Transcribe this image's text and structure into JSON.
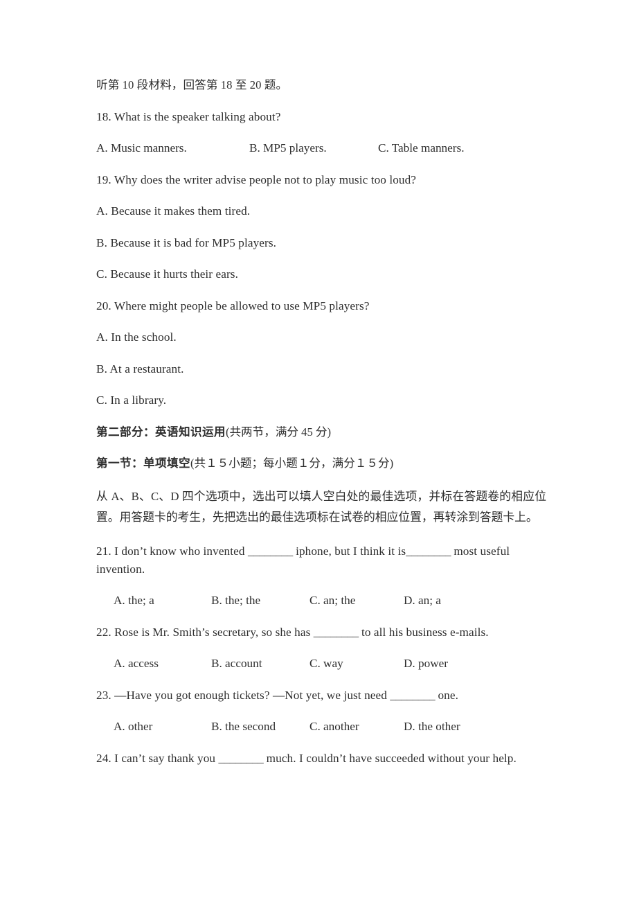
{
  "document": {
    "listening_intro": "听第 10 段材料，回答第 18 至 20 题。",
    "questions": [
      {
        "stem": "18. What is the speaker talking about?",
        "options_inline": [
          "A. Music manners.",
          "B. MP5 players.",
          "C. Table manners."
        ]
      },
      {
        "stem": "19. Why does the writer advise people not to play music too loud?",
        "options_stacked": [
          "A. Because it makes them tired.",
          "B. Because it is bad for MP5 players.",
          "C. Because it hurts their ears."
        ]
      },
      {
        "stem": "20. Where might people be allowed to use MP5 players?",
        "options_stacked": [
          "A. In the school.",
          "B. At a restaurant.",
          "C. In a library."
        ]
      }
    ],
    "section_part2": {
      "lead": "第二部分：英语知识运用",
      "rest": "(共两节，满分 45 分)"
    },
    "section_part2_sub1": {
      "lead": "第一节：单项填空",
      "rest": "(共１５小题；每小题１分，满分１５分)"
    },
    "instructions": "从 A、B、C、D 四个选项中，选出可以填人空白处的最佳选项，并标在答题卷的相应位置。用答题卡的考生，先把选出的最佳选项标在试卷的相应位置，再转涂到答题卡上。",
    "grammar_questions": [
      {
        "stem_pre": "21. I don’t know who invented ",
        "blank1": "________",
        "stem_mid": " iphone, but I think it is",
        "blank2": "________",
        "stem_post": " most useful invention.",
        "options": [
          "A. the; a",
          "B. the; the",
          "C. an; the",
          "D. an; a"
        ]
      },
      {
        "stem_pre": "22. Rose is Mr. Smith’s secretary, so she has ",
        "blank1": "________",
        "stem_post": " to all his business e-mails.",
        "options": [
          "A. access",
          "B. account",
          "C. way",
          "D. power"
        ]
      },
      {
        "stem_pre": "23. —Have you got enough tickets?  —Not yet, we just need ",
        "blank1": "________",
        "stem_post": " one.",
        "options": [
          "A. other",
          "B. the second",
          "C. another",
          "D. the other"
        ]
      },
      {
        "stem_pre": "24. I can’t say thank you ",
        "blank1": "________",
        "stem_post": " much. I couldn’t have succeeded without your help.",
        "options": []
      }
    ]
  }
}
